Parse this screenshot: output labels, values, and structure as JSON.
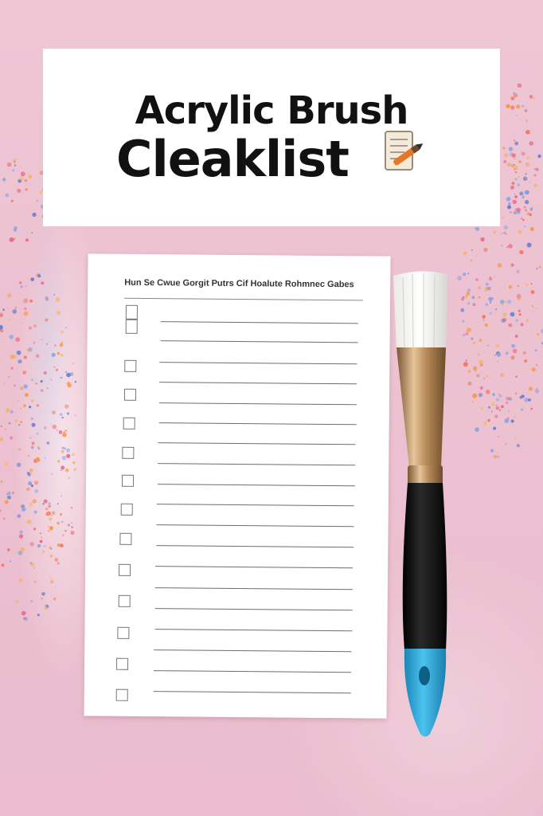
{
  "title": {
    "line1": "Acrylic Brush",
    "line2": "Cleaklist"
  },
  "icons": {
    "title_icon": "memo-with-brush-icon",
    "brush": "paint-brush"
  },
  "checklist": {
    "header": "Hun Se Cwue Gorgit Putrs Cif Hoalute  Rohmnec Gabes",
    "items": 14
  },
  "colors": {
    "background": "#ecc3d2",
    "card": "#ffffff",
    "text": "#111111",
    "brush_handle": "#111111",
    "brush_tip": "#2aa8d8",
    "ferrule": "#c9a070"
  }
}
